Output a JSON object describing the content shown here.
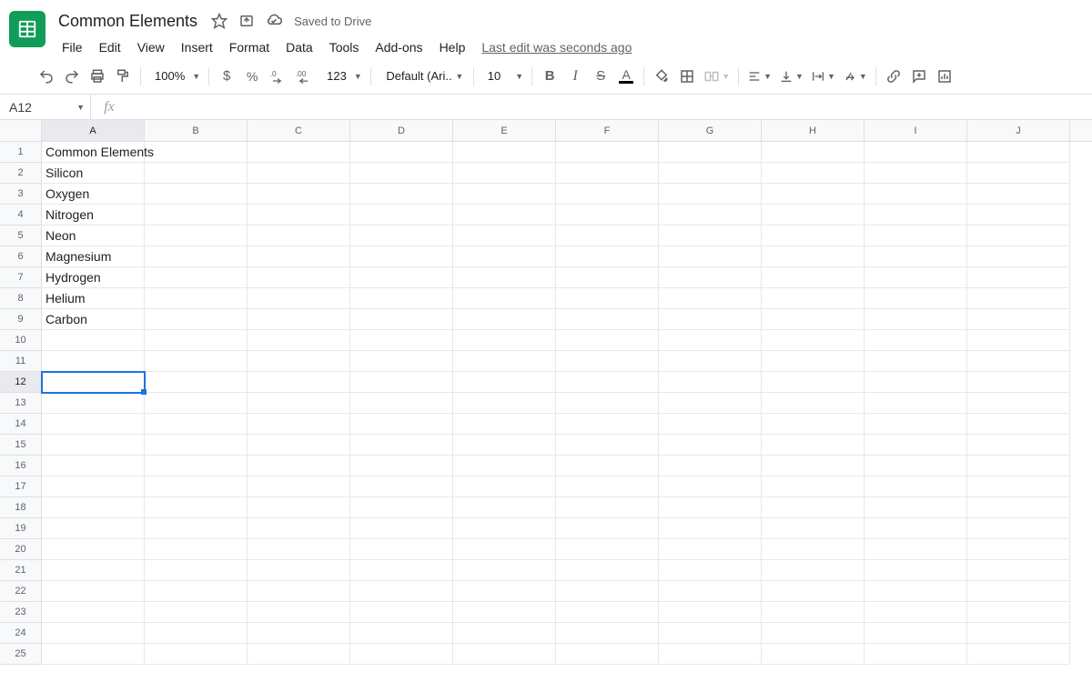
{
  "doc": {
    "title": "Common Elements",
    "saved_label": "Saved to Drive"
  },
  "menus": [
    "File",
    "Edit",
    "View",
    "Insert",
    "Format",
    "Data",
    "Tools",
    "Add-ons",
    "Help"
  ],
  "last_edit": "Last edit was seconds ago",
  "toolbar": {
    "zoom": "100%",
    "font": "Default (Ari...",
    "font_size": "10",
    "format_more": "123"
  },
  "name_box": "A12",
  "fx": "fx",
  "formula_value": "",
  "columns": [
    "A",
    "B",
    "C",
    "D",
    "E",
    "F",
    "G",
    "H",
    "I",
    "J"
  ],
  "row_count": 25,
  "selected": {
    "row": 12,
    "col": 0
  },
  "cells": {
    "A1": "Common Elements",
    "A2": "Silicon",
    "A3": "Oxygen",
    "A4": "Nitrogen",
    "A5": "Neon",
    "A6": "Magnesium",
    "A7": "Hydrogen",
    "A8": "Helium",
    "A9": "Carbon"
  }
}
